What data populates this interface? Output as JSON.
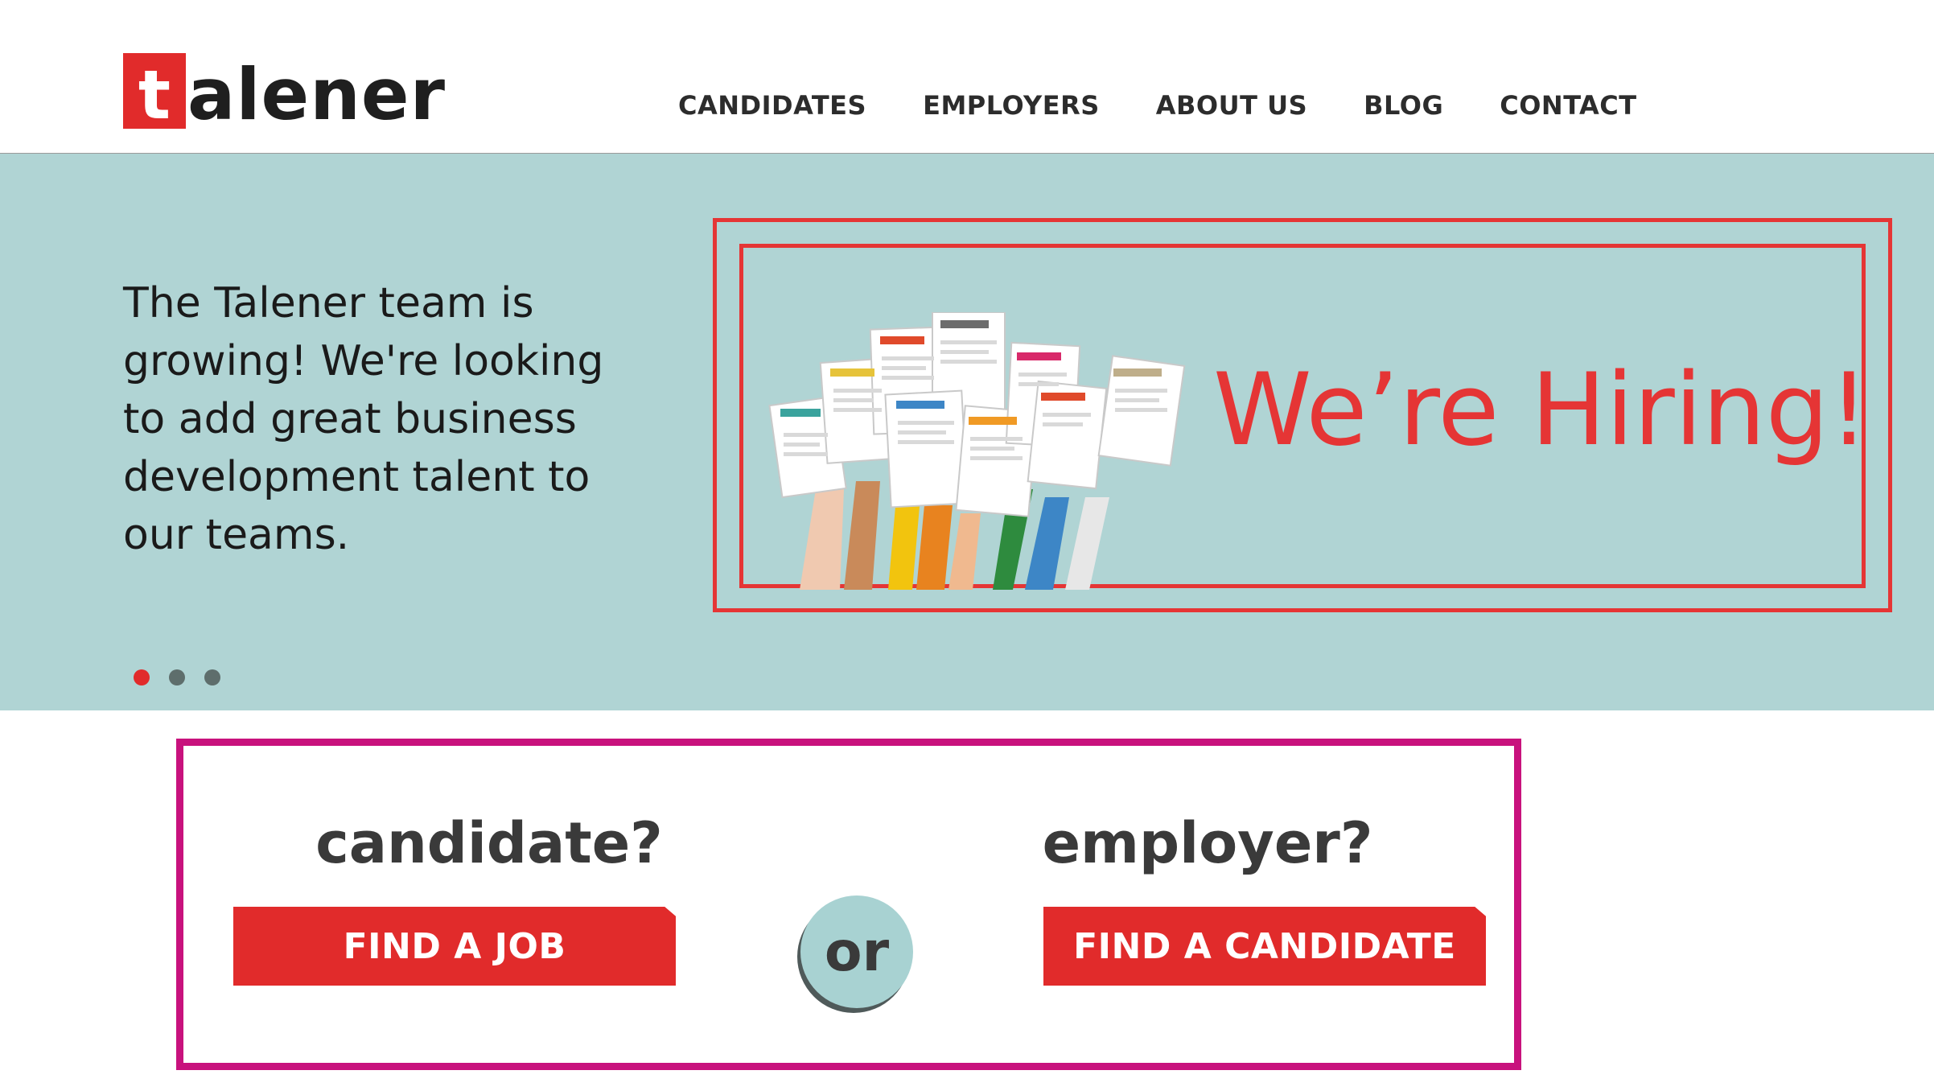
{
  "header": {
    "logo": {
      "mark": "t",
      "rest": "alener"
    },
    "nav": [
      {
        "label": "CANDIDATES"
      },
      {
        "label": "EMPLOYERS"
      },
      {
        "label": "ABOUT US"
      },
      {
        "label": "BLOG"
      },
      {
        "label": "CONTACT"
      }
    ]
  },
  "hero": {
    "text": "The Talener team is growing! We're looking to add great business development talent to our teams.",
    "banner_text": "We’re Hiring!",
    "carousel": {
      "total": 3,
      "active": 1
    }
  },
  "cta": {
    "candidate_heading": "candidate?",
    "employer_heading": "employer?",
    "find_job_label": "FIND A JOB",
    "or_label": "or",
    "find_candidate_label": "FIND A CANDIDATE"
  },
  "colors": {
    "brand_red": "#e12b2b",
    "hero_bg": "#b0d4d4",
    "cta_border": "#c8127d"
  }
}
